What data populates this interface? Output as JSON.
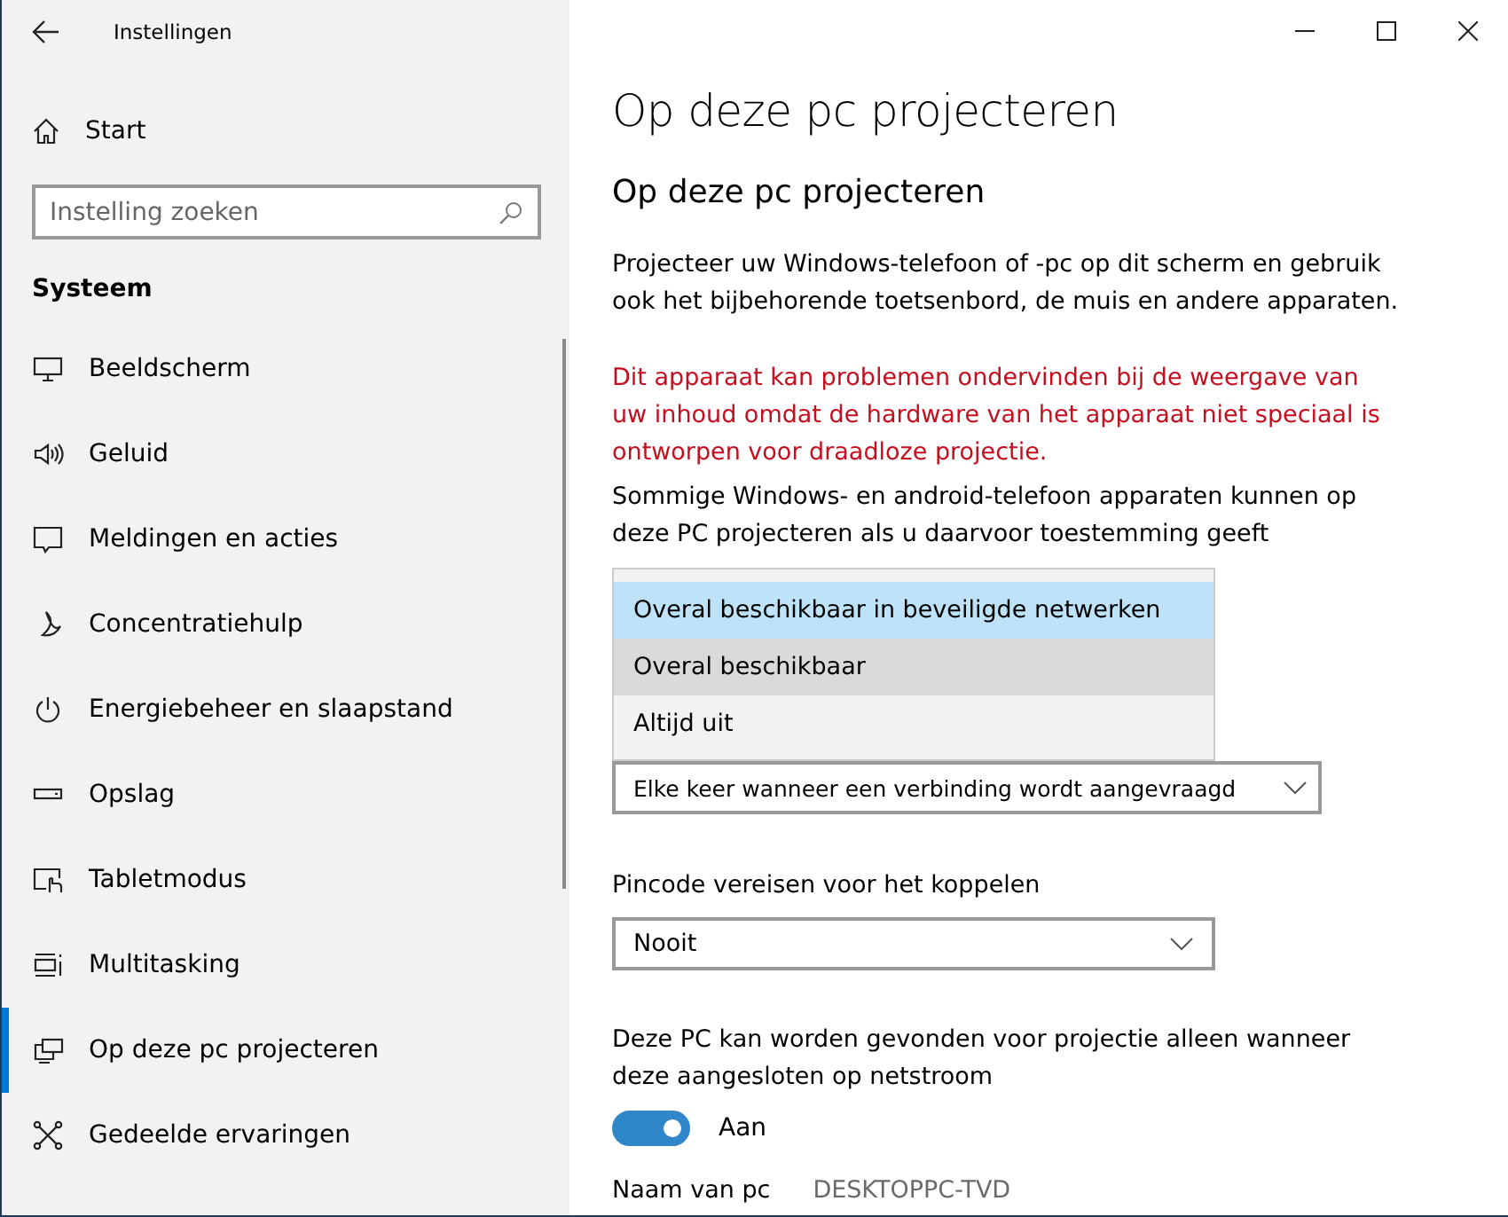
{
  "window": {
    "title": "Instellingen",
    "controls": [
      {
        "kind": "minimize"
      },
      {
        "kind": "maximize"
      },
      {
        "kind": "close"
      }
    ]
  },
  "sidebar": {
    "home": {
      "label": "Start"
    },
    "search": {
      "placeholder": "Instelling zoeken"
    },
    "section": "Systeem",
    "items": [
      {
        "kind": "monitor",
        "label": "Beeldscherm",
        "selected": false
      },
      {
        "kind": "speaker",
        "label": "Geluid",
        "selected": false
      },
      {
        "kind": "message",
        "label": "Meldingen en acties",
        "selected": false
      },
      {
        "kind": "moon",
        "label": "Concentratiehulp",
        "selected": false
      },
      {
        "kind": "power",
        "label": "Energiebeheer en slaapstand",
        "selected": false
      },
      {
        "kind": "drive",
        "label": "Opslag",
        "selected": false
      },
      {
        "kind": "tablet",
        "label": "Tabletmodus",
        "selected": false
      },
      {
        "kind": "multitask",
        "label": "Multitasking",
        "selected": false
      },
      {
        "kind": "project",
        "label": "Op deze pc projecteren",
        "selected": true
      },
      {
        "kind": "share",
        "label": "Gedeelde ervaringen",
        "selected": false
      }
    ]
  },
  "main": {
    "title": "Op deze pc projecteren",
    "subtitle": "Op deze pc projecteren",
    "intro": "Projecteer uw Windows-telefoon of -pc op dit scherm en gebruik ook het bijbehorende toetsenbord, de muis en andere apparaten.",
    "warning": "Dit apparaat kan problemen ondervinden bij de weergave van uw inhoud omdat de hardware van het apparaat niet speciaal is ontworpen voor draadloze projectie.",
    "availability_label": "Sommige Windows- en android-telefoon apparaten kunnen op deze PC projecteren als u daarvoor toestemming geeft",
    "availability_options": [
      {
        "label": "Overal beschikbaar in beveiligde netwerken",
        "selected": true,
        "hover": false
      },
      {
        "label": "Overal beschikbaar",
        "selected": false,
        "hover": true
      },
      {
        "label": "Altijd uit",
        "selected": false,
        "hover": false
      }
    ],
    "ask_dropdown": {
      "value": "Elke keer wanneer een verbinding wordt aangevraagd"
    },
    "pin_label": "Pincode vereisen voor het koppelen",
    "pin_dropdown": {
      "value": "Nooit"
    },
    "power_label": "Deze PC kan worden gevonden voor projectie alleen wanneer deze aangesloten op netstroom",
    "power_toggle": {
      "on": true,
      "label": "Aan"
    },
    "pc_name_label": "Naam van pc",
    "pc_name": "DESKTOPPC-TVD"
  }
}
